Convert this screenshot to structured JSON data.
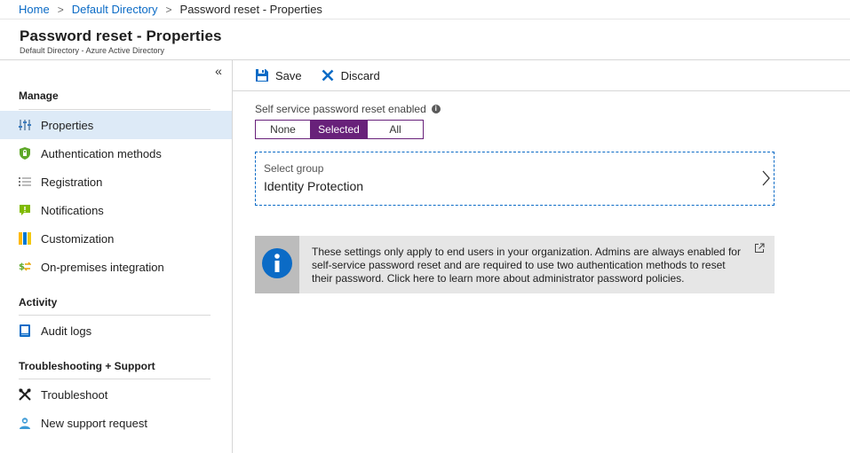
{
  "breadcrumb": {
    "items": [
      "Home",
      "Default Directory",
      "Password reset - Properties"
    ]
  },
  "header": {
    "title": "Password reset - Properties",
    "subtitle": "Default Directory - Azure Active Directory"
  },
  "sidebar": {
    "collapse_glyph": "«",
    "sections": [
      {
        "title": "Manage",
        "items": [
          {
            "label": "Properties",
            "icon": "properties-sliders-icon",
            "active": true
          },
          {
            "label": "Authentication methods",
            "icon": "shield-lock-icon"
          },
          {
            "label": "Registration",
            "icon": "checklist-icon"
          },
          {
            "label": "Notifications",
            "icon": "notification-icon"
          },
          {
            "label": "Customization",
            "icon": "palette-icon"
          },
          {
            "label": "On-premises integration",
            "icon": "sync-icon"
          }
        ]
      },
      {
        "title": "Activity",
        "items": [
          {
            "label": "Audit logs",
            "icon": "audit-log-icon"
          }
        ]
      },
      {
        "title": "Troubleshooting + Support",
        "items": [
          {
            "label": "Troubleshoot",
            "icon": "wrench-icon"
          },
          {
            "label": "New support request",
            "icon": "support-person-icon"
          }
        ]
      }
    ]
  },
  "toolbar": {
    "save_label": "Save",
    "discard_label": "Discard"
  },
  "sspr": {
    "label": "Self service password reset enabled",
    "info_glyph": "i",
    "options": [
      "None",
      "Selected",
      "All"
    ],
    "selected": "Selected"
  },
  "group": {
    "label": "Select group",
    "value": "Identity Protection"
  },
  "info": {
    "text": "These settings only apply to end users in your organization. Admins are always enabled for self-service password reset and are required to use two authentication methods to reset their password. Click here to learn more about administrator password policies."
  },
  "colors": {
    "accent": "#0b6bc6",
    "selected_segment": "#68217a",
    "active_nav": "#ddeaf7"
  }
}
